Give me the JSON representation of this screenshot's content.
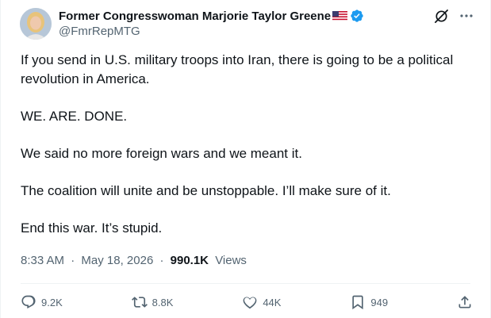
{
  "author": {
    "display_name": "Former Congresswoman Marjorie Taylor Greene",
    "handle": "@FmrRepMTG",
    "flag": "us-flag",
    "verified_badge": "verified-badge-icon"
  },
  "top_icons": [
    "grok-icon",
    "more-icon"
  ],
  "tweet": {
    "paragraphs": [
      "If you send in U.S. military troops into Iran, there is going to be a political revolution in America.",
      "WE. ARE. DONE.",
      "We said no more foreign wars and we meant it.",
      "The coalition will unite and be unstoppable. I’ll make sure of it.",
      "End this war. It’s stupid."
    ]
  },
  "meta": {
    "time": "8:33 AM",
    "separator": "·",
    "date": "May 18, 2026",
    "views_count": "990.1K",
    "views_label": "Views"
  },
  "actions": {
    "replies": "9.2K",
    "reposts": "8.8K",
    "likes": "44K",
    "bookmarks": "949"
  },
  "colors": {
    "text": "#0f1419",
    "secondary": "#536471",
    "verified": "#1d9bf0",
    "divider": "#eff3f4"
  }
}
